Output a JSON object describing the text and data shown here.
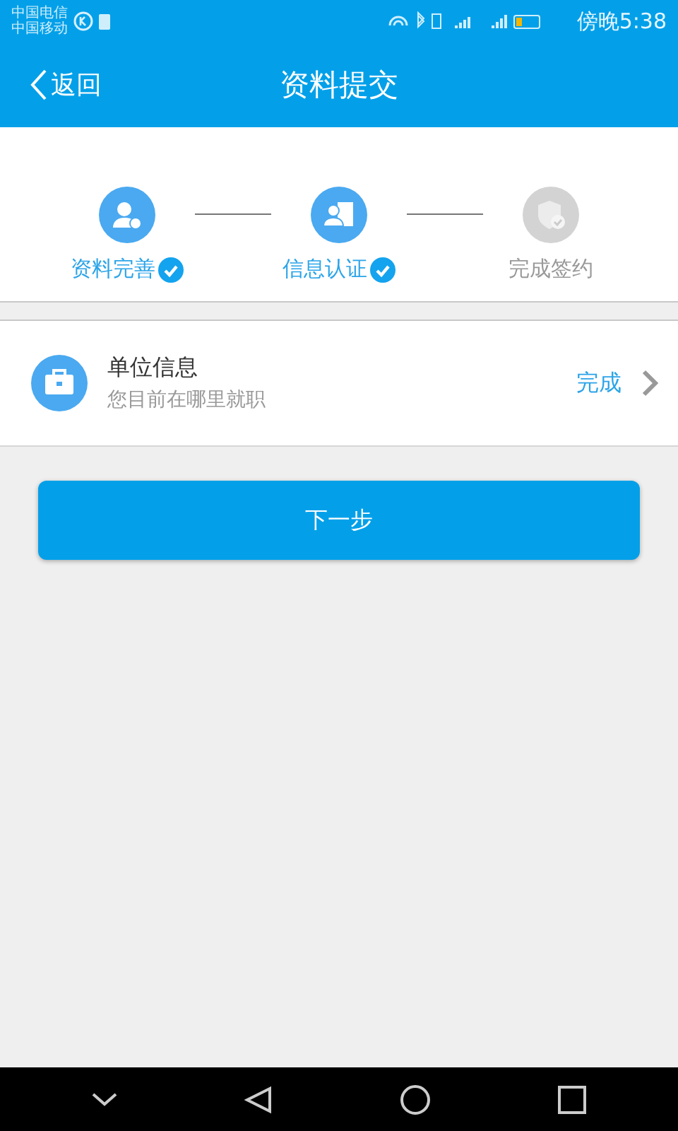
{
  "status_bar": {
    "carriers": [
      "中国电信",
      "中国移动"
    ],
    "time": "傍晚5:38"
  },
  "nav": {
    "back": "返回",
    "title": "资料提交"
  },
  "steps": [
    {
      "label": "资料完善",
      "done": true,
      "kind": "person"
    },
    {
      "label": "信息认证",
      "done": true,
      "kind": "card"
    },
    {
      "label": "完成签约",
      "done": false,
      "kind": "shield"
    }
  ],
  "entry": {
    "title": "单位信息",
    "subtitle": "您目前在哪里就职",
    "status": "完成"
  },
  "next_button": "下一步"
}
